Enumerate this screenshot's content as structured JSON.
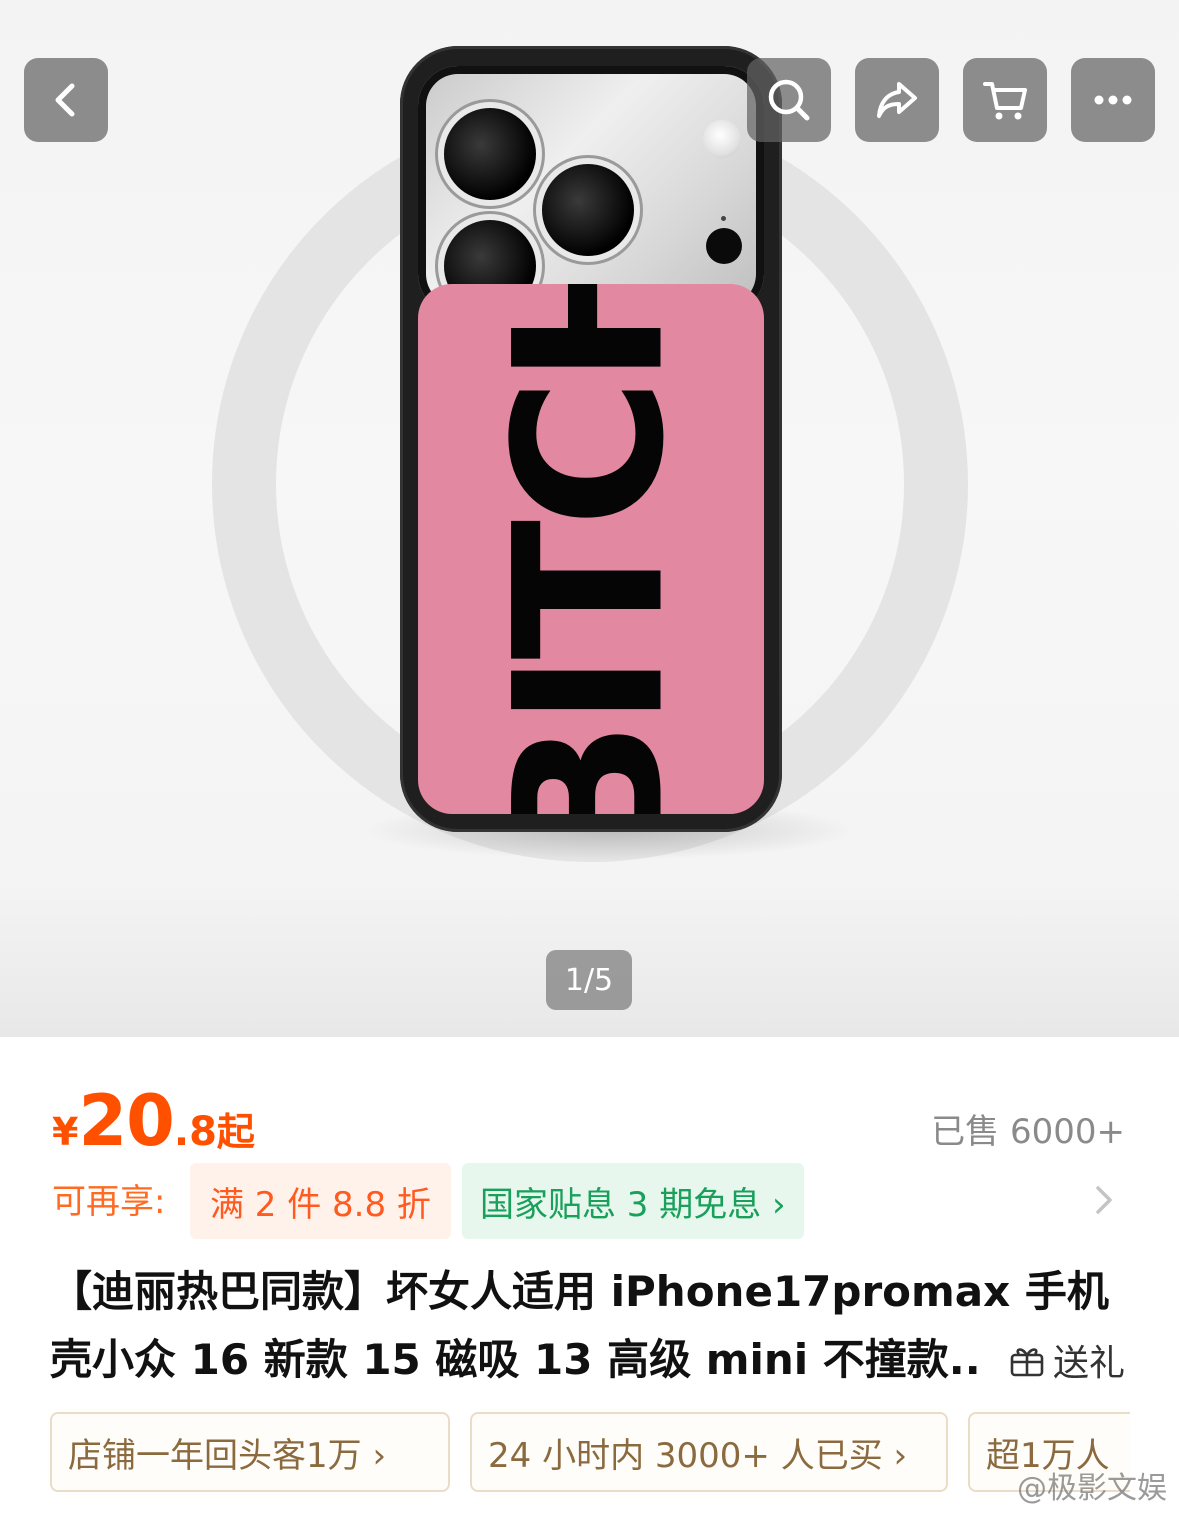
{
  "gallery": {
    "product_print_text": "BITCH",
    "indicator": "1/5"
  },
  "nav": {
    "back_icon": "chevron-left-icon",
    "search_icon": "search-icon",
    "share_icon": "share-icon",
    "cart_icon": "cart-icon",
    "more_icon": "more-icon"
  },
  "price": {
    "symbol": "¥",
    "integer": "20",
    "decimal": ".8",
    "suffix": "起",
    "color": "#ff5000"
  },
  "sold": "已售 6000+",
  "promotions": {
    "label": "可再享:",
    "discount": "满 2 件 8.8 折",
    "installment": "国家贴息 3 期免息 ›"
  },
  "title": {
    "line1": "【迪丽热巴同款】坏女人适用 iPhone17promax 手机",
    "line2": "壳小众 16 新款 15 磁吸 13 高级 mini 不撞款..."
  },
  "gift": {
    "label": "送礼"
  },
  "tags": [
    "店铺一年回头客1万 ›",
    "24 小时内 3000+ 人已买 ›",
    "超1万人"
  ],
  "watermark": "@极影文娱"
}
